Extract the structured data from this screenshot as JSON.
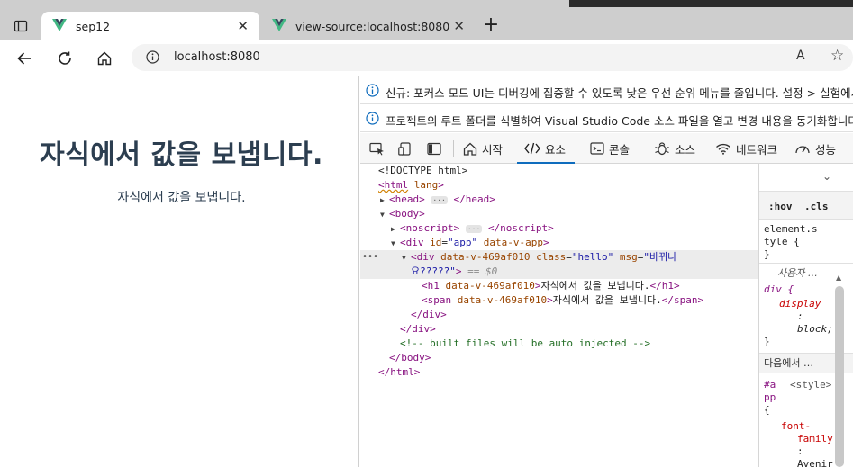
{
  "browser": {
    "tabs": [
      {
        "title": "sep12",
        "active": true
      },
      {
        "title": "view-source:localhost:8080",
        "active": false
      }
    ],
    "close_glyph": "✕",
    "new_tab_glyph": "+",
    "url": "localhost:8080",
    "read_aloud_glyph": "A",
    "star_glyph": "☆"
  },
  "page": {
    "heading": "자식에서 값을 보냅니다.",
    "span_text": "자식에서 값을 보냅니다."
  },
  "devtools": {
    "notices": [
      "신규: 포커스 모드 UI는 디버깅에 집중할 수 있도록 낮은 우선 순위 메뉴를 줄입니다. 설정 > 실험에서",
      "프로젝트의 루트 폴더를 식별하여 Visual Studio Code 소스 파일을 열고 변경 내용을 동기화합니다."
    ],
    "tabs": [
      {
        "label": "시작",
        "icon": "home-icon"
      },
      {
        "label": "요소",
        "icon": "code-icon",
        "active": true
      },
      {
        "label": "콘솔",
        "icon": "console-icon"
      },
      {
        "label": "소스",
        "icon": "bug-icon"
      },
      {
        "label": "네트워크",
        "icon": "wifi-icon"
      },
      {
        "label": "성능",
        "icon": "gauge-icon"
      }
    ],
    "tree": {
      "doctype": "<!DOCTYPE html>",
      "html_open": "<html",
      "html_attr": "lang",
      "head_open": "<head>",
      "head_close": "</head>",
      "body_open": "<body>",
      "noscript_open": "<noscript>",
      "noscript_close": "</noscript>",
      "app_div_open": "<div",
      "app_attr1_name": "id",
      "app_attr1_value": "\"app\"",
      "app_attr2_name": "data-v-app",
      "hello_div_open": "<div",
      "hello_attr1_name": "data-v-469af010",
      "hello_attr2_name": "class",
      "hello_attr2_value": "\"hello\"",
      "hello_attr3_name": "msg",
      "hello_attr3_value_line1": "\"바뀌나",
      "hello_attr3_value_line2": "요?????\"",
      "eq_marker": "== $0",
      "h1_open": "<h1",
      "h1_attr": "data-v-469af010",
      "h1_text": "자식에서 값을 보냅니다.",
      "h1_close": "</h1>",
      "span_open": "<span",
      "span_attr": "data-v-469af010",
      "span_text": "자식에서 값을 보냅니다.",
      "span_close": "</span>",
      "div_close": "</div>",
      "comment": "<!-- built files will be auto injected -->",
      "body_close": "</body>",
      "html_close": "</html>",
      "ellipsis": "···",
      "dots": "•••"
    },
    "styles": {
      "hov": ":hov",
      "cls": ".cls",
      "element_style_1": "element.s",
      "element_style_2": "tyle {",
      "close_brace": "}",
      "user_agent": "사용자 …",
      "div_selector": "div {",
      "display_prop": "display",
      "colon": ":",
      "display_value": "block;",
      "inherited_label": "다음에서 …",
      "app_selector_1": "#a",
      "style_source": "<style>",
      "app_selector_2": "pp",
      "open_brace": "{",
      "font_prop_1": "font-",
      "font_prop_2": "family",
      "font_value": "Avenir"
    }
  }
}
